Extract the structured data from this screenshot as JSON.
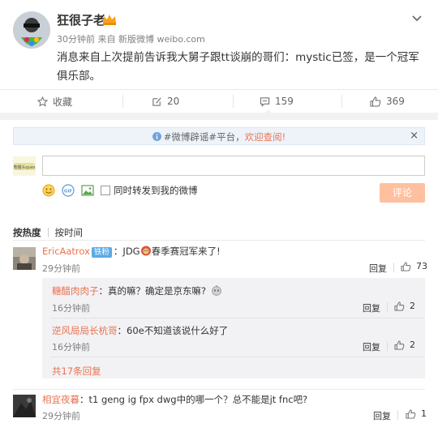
{
  "post": {
    "username": "狂很子老",
    "meta": "30分钟前 来自 新版微博 weibo.com",
    "text": "消息来自上次提前告诉我大舅子跟tt谈崩的哥们：mystic已签，是一个冠军俱乐部。"
  },
  "actions": {
    "favorite": "收藏",
    "repost": "20",
    "comment": "159",
    "like": "369"
  },
  "notice": {
    "prefix": "#微博辟谣#平台，",
    "link": "欢迎查阅!",
    "close": "×"
  },
  "composer": {
    "self_avatar_text": "熊猫头ques",
    "placeholder": "",
    "sync_label": "同时转发到我的微博",
    "submit_label": "评论"
  },
  "sort": {
    "by_hot": "按热度",
    "by_time": "按时间"
  },
  "comments": [
    {
      "name": "EricAatrox",
      "badge": "铁粉",
      "text_before": "：JDG",
      "text_after": "春季赛冠军来了!",
      "time": "29分钟前",
      "reply_label": "回复",
      "likes": "73"
    },
    {
      "name": "相宜夜暮",
      "text": "：t1  geng ig fpx dwg中的哪一个？总不能是jt fnc吧?",
      "time": "29分钟前",
      "reply_label": "回复",
      "likes": "1"
    }
  ],
  "sub_replies": [
    {
      "name": "糖醋肉肉子",
      "text": "：真的嘛？确定是京东嘛?",
      "time": "16分钟前",
      "reply_label": "回复",
      "likes": "2"
    },
    {
      "name": "逆风局局长杭哥",
      "text": "：60e不知道该说什么好了",
      "time": "16分钟前",
      "reply_label": "回复",
      "likes": "2"
    }
  ],
  "more_replies": "共17条回复",
  "colors": {
    "accent": "#eb7350",
    "submit_bg": "#ffc09f",
    "fan_badge": "#5ca9e4",
    "notice_bg": "#eef3f9"
  }
}
